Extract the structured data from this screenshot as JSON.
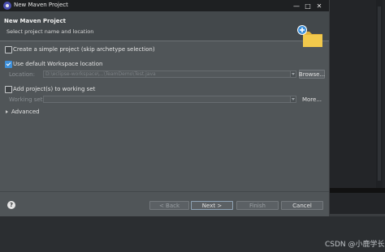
{
  "window": {
    "title": "New Maven Project",
    "minimize": "—",
    "maximize": "□",
    "close": "✕"
  },
  "header": {
    "title": "New Maven Project",
    "subtitle": "Select project name and location"
  },
  "options": {
    "simple_project": {
      "label": "Create a simple project (skip archetype selection)",
      "checked": false
    },
    "default_workspace": {
      "label": "Use default Workspace location",
      "checked": true
    },
    "location": {
      "label": "Location:",
      "value": "D:\\eclipse-workspace\\...\\TeamDemo\\Test.java",
      "browse": "Browse..."
    },
    "working_sets": {
      "label": "Add project(s) to working set",
      "checked": false
    },
    "working_set": {
      "label": "Working set:",
      "value": "",
      "more": "More..."
    },
    "advanced": "Advanced"
  },
  "footer": {
    "help": "?",
    "back": "< Back",
    "next": "Next >",
    "finish": "Finish",
    "cancel": "Cancel"
  },
  "watermark": "CSDN @小鹿学长",
  "colors": {
    "dialog_bg": "#505558",
    "header_bg": "#43484b",
    "check_accent": "#3f8fd8",
    "icon_folder": "#f2c94c",
    "icon_plus": "#3b8fd9"
  },
  "icons": {
    "title": "eclipse-app-icon",
    "header": "new-folder-plus-icon",
    "help": "help-circle-icon"
  }
}
